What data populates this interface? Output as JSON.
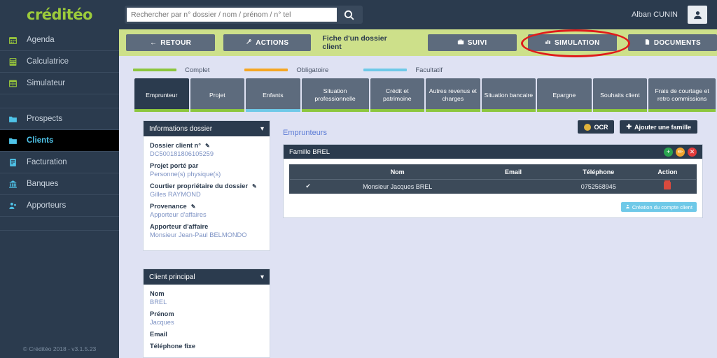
{
  "brand": {
    "name": "créditéo"
  },
  "search": {
    "placeholder": "Rechercher par n° dossier / nom / prénom / n° tel",
    "value": ""
  },
  "user": {
    "name": "Alban CUNIN"
  },
  "sidebar": {
    "items": [
      {
        "label": "Agenda",
        "icon": "calendar-icon",
        "color": "green",
        "active": false
      },
      {
        "label": "Calculatrice",
        "icon": "calculator-icon",
        "color": "green",
        "active": false
      },
      {
        "label": "Simulateur",
        "icon": "table-icon",
        "color": "green",
        "active": false
      },
      {
        "label": "Prospects",
        "icon": "folder-icon",
        "color": "blue",
        "active": false
      },
      {
        "label": "Clients",
        "icon": "folder-icon",
        "color": "blue",
        "active": true
      },
      {
        "label": "Facturation",
        "icon": "invoice-icon",
        "color": "blue",
        "active": false
      },
      {
        "label": "Banques",
        "icon": "bank-icon",
        "color": "blue",
        "active": false
      },
      {
        "label": "Apporteurs",
        "icon": "handshake-icon",
        "color": "blue",
        "active": false
      }
    ],
    "footer": "© Créditéo 2018 - v3.1.5.23"
  },
  "actionbar": {
    "retour": "RETOUR",
    "actions": "ACTIONS",
    "title": "Fiche d'un dossier client",
    "suivi": "SUIVI",
    "simulation": "SIMULATION",
    "documents": "DOCUMENTS",
    "highlighted": "SIMULATION"
  },
  "legend": [
    {
      "label": "Complet",
      "color": "#8cc63e"
    },
    {
      "label": "Obligatoire",
      "color": "#f5a623"
    },
    {
      "label": "Facultatif",
      "color": "#6fc9e8"
    }
  ],
  "tabs": [
    {
      "label": "Emprunteur",
      "status": "#8cc63e",
      "active": true
    },
    {
      "label": "Projet",
      "status": "#8cc63e",
      "active": false
    },
    {
      "label": "Enfants",
      "status": "#6fc9e8",
      "active": false
    },
    {
      "label": "Situation professionnelle",
      "status": "#8cc63e",
      "active": false
    },
    {
      "label": "Crédit et patrimoine",
      "status": "#8cc63e",
      "active": false
    },
    {
      "label": "Autres revenus et charges",
      "status": "#8cc63e",
      "active": false
    },
    {
      "label": "Situation bancaire",
      "status": "#8cc63e",
      "active": false
    },
    {
      "label": "Epargne",
      "status": "#8cc63e",
      "active": false
    },
    {
      "label": "Souhaits client",
      "status": "#8cc63e",
      "active": false
    },
    {
      "label": "Frais de courtage et retro commissions",
      "status": "#8cc63e",
      "active": false
    }
  ],
  "panel_infos": {
    "title": "Informations dossier",
    "fields": [
      {
        "label": "Dossier client n°",
        "value": "DC500181806105259",
        "editable": true
      },
      {
        "label": "Projet porté par",
        "value": "Personne(s) physique(s)",
        "editable": false
      },
      {
        "label": "Courtier propriétaire du dossier",
        "value": "Gilles RAYMOND",
        "editable": true
      },
      {
        "label": "Provenance",
        "value": "Apporteur d'affaires",
        "editable": true
      },
      {
        "label": "Apporteur d'affaire",
        "value": "Monsieur Jean-Paul BELMONDO",
        "editable": false
      }
    ]
  },
  "panel_client": {
    "title": "Client principal",
    "fields": [
      {
        "label": "Nom",
        "value": "BREL",
        "editable": false
      },
      {
        "label": "Prénom",
        "value": "Jacques",
        "editable": false
      },
      {
        "label": "Email",
        "value": "",
        "editable": false
      },
      {
        "label": "Téléphone fixe",
        "value": "",
        "editable": false
      }
    ]
  },
  "main": {
    "section_title": "Emprunteurs",
    "ocr_button": "OCR",
    "add_family_button": "Ajouter une famille",
    "family": {
      "name": "Famille BREL",
      "actions": [
        {
          "name": "add",
          "glyph": "+",
          "color": "#2aa44f"
        },
        {
          "name": "edit",
          "glyph": "✏",
          "color": "#f0a32e"
        },
        {
          "name": "delete",
          "glyph": "✕",
          "color": "#e23c3c"
        }
      ],
      "table": {
        "columns": [
          "",
          "Nom",
          "Email",
          "Téléphone",
          "Action"
        ],
        "rows": [
          {
            "status": "✔",
            "nom": "Monsieur Jacques BREL",
            "email": "",
            "telephone": "0752568945",
            "action": "delete-icon"
          }
        ]
      },
      "create_account_button": "Création du compte client"
    }
  }
}
